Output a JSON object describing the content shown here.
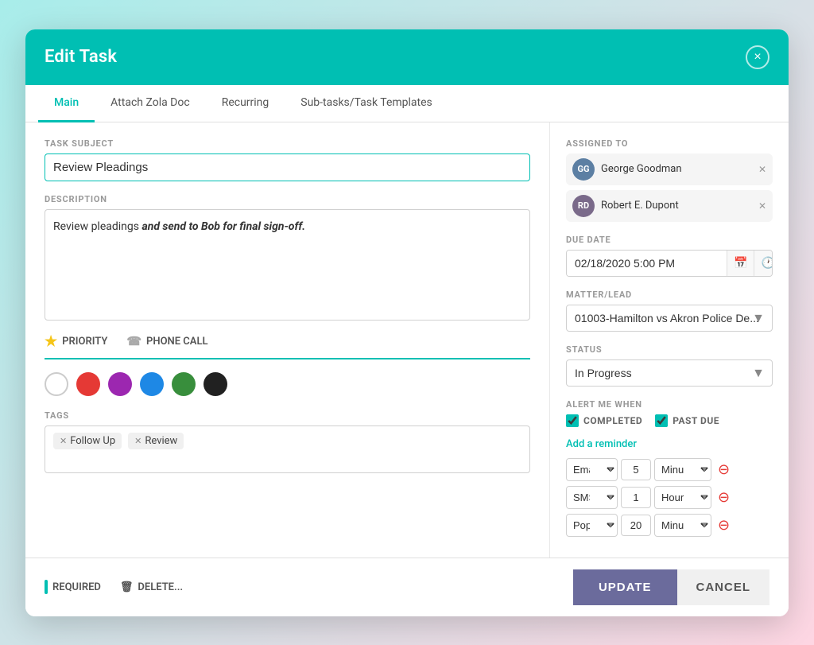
{
  "modal": {
    "title": "Edit Task",
    "close_label": "×"
  },
  "tabs": [
    {
      "id": "main",
      "label": "Main",
      "active": true
    },
    {
      "id": "attach",
      "label": "Attach Zola Doc",
      "active": false
    },
    {
      "id": "recurring",
      "label": "Recurring",
      "active": false
    },
    {
      "id": "subtasks",
      "label": "Sub-tasks/Task Templates",
      "active": false
    }
  ],
  "left": {
    "task_subject_label": "TASK SUBJECT",
    "task_subject_value": "Review Pleadings",
    "description_label": "DESCRIPTION",
    "description_plain": "Review pleadings ",
    "description_bold_italic": "and send to Bob for final sign-off.",
    "priority_label": "PRIORITY",
    "phone_call_label": "PHONE CALL",
    "tags_label": "TAGS",
    "tags": [
      {
        "id": "follow-up",
        "label": "Follow Up"
      },
      {
        "id": "review",
        "label": "Review"
      }
    ]
  },
  "right": {
    "assigned_to_label": "ASSIGNED TO",
    "assignees": [
      {
        "id": "gg",
        "initials": "GG",
        "name": "George Goodman"
      },
      {
        "id": "rd",
        "initials": "RD",
        "name": "Robert E. Dupont"
      }
    ],
    "due_date_label": "DUE DATE",
    "due_date_value": "02/18/2020 5:00 PM",
    "matter_label": "MATTER/LEAD",
    "matter_value": "01003-Hamilton vs Akron Police De...",
    "status_label": "STATUS",
    "status_value": "In Progress",
    "alert_label": "ALERT ME WHEN",
    "completed_label": "COMPLETED",
    "past_due_label": "PAST DUE",
    "add_reminder_label": "Add a reminder",
    "reminders": [
      {
        "type": "Email",
        "num": "5",
        "unit": "Minute"
      },
      {
        "type": "SMS",
        "num": "1",
        "unit": "Hour"
      },
      {
        "type": "Pop up",
        "num": "20",
        "unit": "Minute"
      }
    ]
  },
  "footer": {
    "required_label": "REQUIRED",
    "delete_label": "DELETE...",
    "update_label": "UPDATE",
    "cancel_label": "CANCEL"
  }
}
